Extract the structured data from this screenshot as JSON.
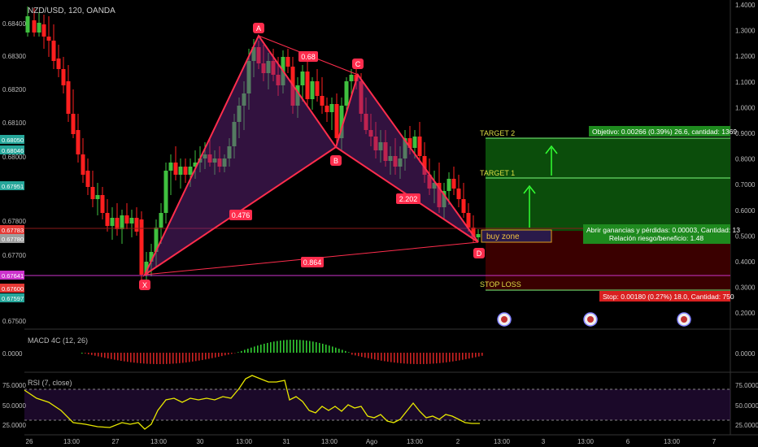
{
  "header": {
    "symbol_line": "NZD/USD, 120, OANDA"
  },
  "price_axis_left": {
    "ticks": [
      "0.68400",
      "0.68300",
      "0.68200",
      "0.68100",
      "0.68000",
      "0.67800",
      "0.67700",
      "0.67500"
    ],
    "badges": [
      {
        "text": "0.68050",
        "color": "#26a69a"
      },
      {
        "text": "0.68046",
        "color": "#26a69a"
      },
      {
        "text": "0.67951",
        "color": "#26a69a"
      },
      {
        "text": "0.67783",
        "color": "#e53935"
      },
      {
        "text": "0.67780",
        "color": "#9e9e9e"
      },
      {
        "text": "0.67641",
        "color": "#cc33cc"
      },
      {
        "text": "0.67600",
        "color": "#e53935"
      },
      {
        "text": "0.67597",
        "color": "#26a69a"
      }
    ]
  },
  "right_axis": {
    "ticks": [
      "1.4000",
      "1.3000",
      "1.2000",
      "1.1000",
      "1.0000",
      "0.9000",
      "0.8000",
      "0.7000",
      "0.6000",
      "0.5000",
      "0.4000",
      "0.3000",
      "0.2000"
    ]
  },
  "pattern": {
    "points": {
      "X": "X",
      "A": "A",
      "B": "B",
      "C": "C",
      "D": "D"
    },
    "ratios": {
      "ab": "0.68",
      "xb": "0.476",
      "bd": "2.202",
      "xd": "0.864"
    }
  },
  "trade": {
    "target2_label": "TARGET 2",
    "target1_label": "TARGET 1",
    "stop_label": "STOP LOSS",
    "buy_zone_label": "buy zone",
    "target_box": "Objetivo: 0.00266 (0.39%) 26.6, cantidad: 1369",
    "center_box_line1": "Abrir ganancias y pérdidas: 0.00003, Cantidad: 13",
    "center_box_line2": "Relación riesgo/beneficio: 1.48",
    "stop_box": "Stop: 0.00180 (0.27%) 18.0, Cantidad: 750"
  },
  "macd": {
    "label": "MACD 4C (12, 26)",
    "left_value": "0.0000",
    "right_value": "0.0000"
  },
  "rsi": {
    "label": "RSI (7, close)",
    "left_ticks": [
      "75.0000",
      "50.0000",
      "25.0000"
    ],
    "right_ticks": [
      "75.0000",
      "50.0000",
      "25.0000"
    ]
  },
  "time_axis": {
    "labels": [
      "26",
      "13:00",
      "27",
      "13:00",
      "30",
      "13:00",
      "31",
      "13:00",
      "Ago",
      "13:00",
      "2",
      "13:00",
      "3",
      "13:00",
      "6",
      "13:00",
      "7"
    ]
  },
  "colors": {
    "bull": "#26a69a",
    "bull_candle": "#3fc03f",
    "bear": "#ff1f1f",
    "pattern": "#ff2d4d",
    "target_zone": "#0b4d0b",
    "stop_zone": "#3a0000",
    "rsi_line": "#e8e800"
  },
  "icons": [
    "event-flag-icon",
    "event-flag-icon",
    "event-flag-icon"
  ]
}
